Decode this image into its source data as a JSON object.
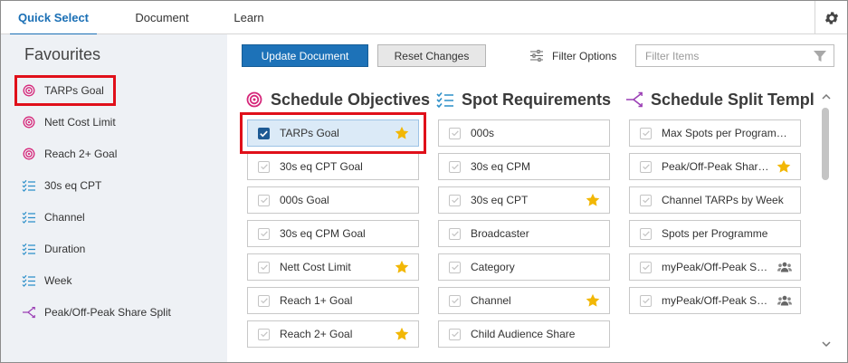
{
  "tabs": [
    {
      "label": "Quick Select"
    },
    {
      "label": "Document"
    },
    {
      "label": "Learn"
    }
  ],
  "sidebar": {
    "title": "Favourites",
    "items": [
      {
        "label": "TARPs Goal",
        "icon": "target-icon"
      },
      {
        "label": "Nett Cost Limit",
        "icon": "target-icon"
      },
      {
        "label": "Reach 2+ Goal",
        "icon": "target-icon"
      },
      {
        "label": "30s eq CPT",
        "icon": "checklist-icon"
      },
      {
        "label": "Channel",
        "icon": "checklist-icon"
      },
      {
        "label": "Duration",
        "icon": "checklist-icon"
      },
      {
        "label": "Week",
        "icon": "checklist-icon"
      },
      {
        "label": "Peak/Off-Peak Share Split",
        "icon": "split-icon"
      }
    ]
  },
  "toolbar": {
    "update_label": "Update Document",
    "reset_label": "Reset Changes",
    "filter_options_label": "Filter Options",
    "filter_placeholder": "Filter Items"
  },
  "columns": {
    "objectives": {
      "title": "Schedule Objectives",
      "items": [
        {
          "label": "TARPs Goal",
          "checked": true,
          "star": true
        },
        {
          "label": "30s eq CPT Goal",
          "checked": false,
          "star": false
        },
        {
          "label": "000s Goal",
          "checked": false,
          "star": false
        },
        {
          "label": "30s eq CPM Goal",
          "checked": false,
          "star": false
        },
        {
          "label": "Nett Cost Limit",
          "checked": false,
          "star": true
        },
        {
          "label": "Reach 1+ Goal",
          "checked": false,
          "star": false
        },
        {
          "label": "Reach 2+ Goal",
          "checked": false,
          "star": true
        }
      ]
    },
    "spot": {
      "title": "Spot Requirements",
      "items": [
        {
          "label": "000s",
          "checked": false,
          "star": false
        },
        {
          "label": "30s eq CPM",
          "checked": false,
          "star": false
        },
        {
          "label": "30s eq CPT",
          "checked": false,
          "star": true
        },
        {
          "label": "Broadcaster",
          "checked": false,
          "star": false
        },
        {
          "label": "Category",
          "checked": false,
          "star": false
        },
        {
          "label": "Channel",
          "checked": false,
          "star": true
        },
        {
          "label": "Child Audience Share",
          "checked": false,
          "star": false
        }
      ]
    },
    "split": {
      "title": "Schedule Split Templa",
      "items": [
        {
          "label": "Max Spots per Programme...",
          "checked": false,
          "star": false,
          "shared": false
        },
        {
          "label": "Peak/Off-Peak Share...",
          "checked": false,
          "star": true,
          "shared": false
        },
        {
          "label": "Channel TARPs by Week",
          "checked": false,
          "star": false,
          "shared": false
        },
        {
          "label": "Spots per Programme",
          "checked": false,
          "star": false,
          "shared": false
        },
        {
          "label": "myPeak/Off-Peak Share...",
          "checked": false,
          "star": false,
          "shared": true
        },
        {
          "label": "myPeak/Off-Peak Share...",
          "checked": false,
          "star": false,
          "shared": true
        }
      ]
    }
  },
  "colors": {
    "accent": "#1a6fb5",
    "primary_button": "#1d72b8",
    "target_icon": "#d6277a",
    "checklist_icon": "#2c8fc9",
    "split_icon": "#9b3fb5",
    "star": "#f2b705",
    "highlight_border": "#e0101a",
    "selected_card": "#dbeaf7"
  }
}
